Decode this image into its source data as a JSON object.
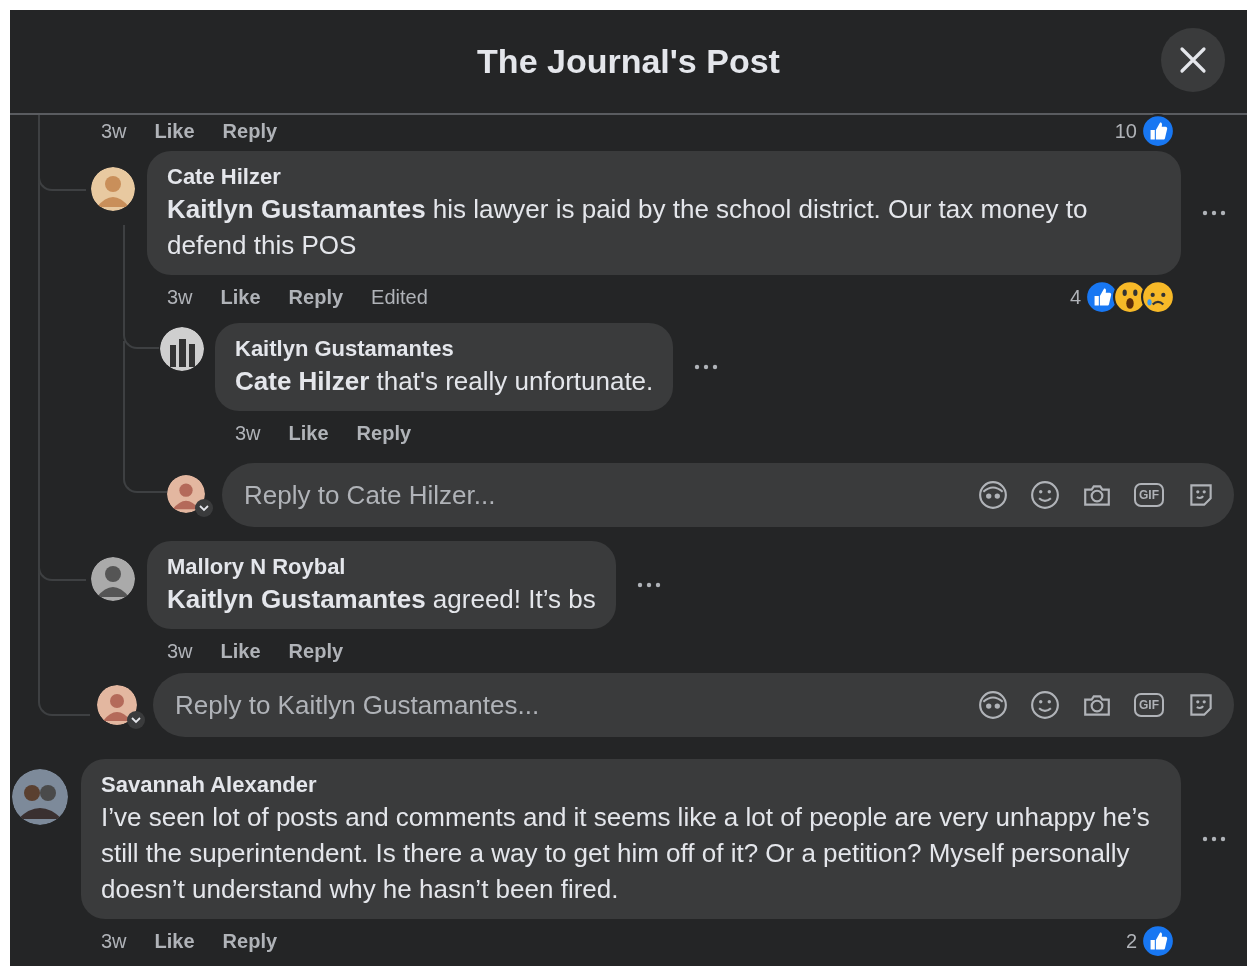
{
  "header": {
    "title": "The Journal's Post"
  },
  "thread": {
    "cut_actions": {
      "time": "3w",
      "like": "Like",
      "reply": "Reply",
      "reaction_count": "10",
      "reactions": [
        {
          "kind": "like"
        }
      ]
    },
    "replies": [
      {
        "author": "Cate Hilzer",
        "text": "**Kaitlyn Gustamantes** his lawyer is paid by the school district. Our tax money to defend this POS",
        "time": "3w",
        "like": "Like",
        "reply": "Reply",
        "edited": "Edited",
        "reaction_count": "4",
        "reactions": [
          {
            "kind": "like"
          },
          {
            "kind": "wow"
          },
          {
            "kind": "sad"
          }
        ],
        "replies": [
          {
            "author": "Kaitlyn Gustamantes",
            "text": "**Cate Hilzer** that's really unfortunate.",
            "time": "3w",
            "like": "Like",
            "reply": "Reply"
          }
        ],
        "reply_box": {
          "placeholder": "Reply to Cate Hilzer...",
          "gif": "GIF"
        }
      },
      {
        "author": "Mallory N Roybal",
        "text": "**Kaitlyn Gustamantes** agreed! It’s bs",
        "time": "3w",
        "like": "Like",
        "reply": "Reply"
      }
    ],
    "reply_box": {
      "placeholder": "Reply to Kaitlyn Gustamantes...",
      "gif": "GIF"
    }
  },
  "comments": [
    {
      "author": "Savannah Alexander",
      "text": "I’ve seen lot of posts and comments and it seems like a lot of people are very unhappy he’s still the superintendent. Is there a way to get him off of it? Or a petition? Myself personally doesn’t understand why he hasn’t been fired.",
      "time": "3w",
      "like": "Like",
      "reply": "Reply",
      "reaction_count": "2",
      "reactions": [
        {
          "kind": "like"
        }
      ]
    }
  ]
}
